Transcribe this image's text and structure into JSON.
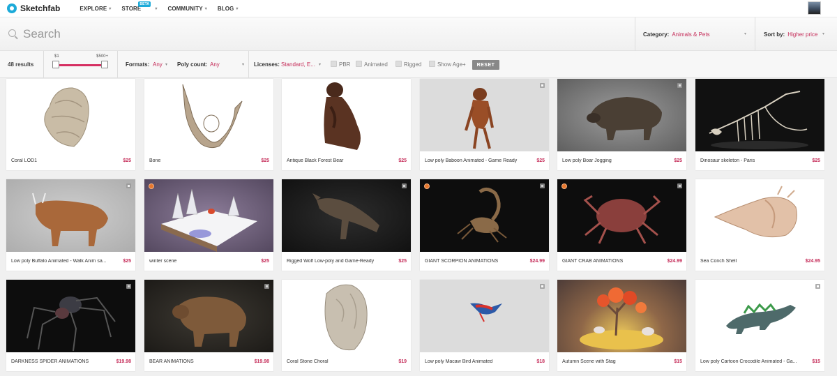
{
  "nav": {
    "logo_text": "Sketchfab",
    "items": [
      {
        "label": "EXPLORE"
      },
      {
        "label": "STORE",
        "badge": "BETA"
      },
      {
        "label": "COMMUNITY"
      },
      {
        "label": "BLOG"
      }
    ]
  },
  "search": {
    "placeholder": "Search"
  },
  "category": {
    "label": "Category:",
    "value": "Animals & Pets"
  },
  "sort": {
    "label": "Sort by:",
    "value": "Higher price"
  },
  "filters": {
    "results": "48 results",
    "price_min": "$1",
    "price_max": "$500+",
    "formats_label": "Formats:",
    "formats_value": "Any",
    "poly_label": "Poly count:",
    "poly_value": "Any",
    "licenses_label": "Licenses:",
    "licenses_value": "Standard, E...",
    "checkboxes": [
      "PBR",
      "Animated",
      "Rigged",
      "Show Age+"
    ],
    "reset_label": "RESET"
  },
  "models": [
    {
      "title": "Coral LOD1",
      "price": "$25"
    },
    {
      "title": "Bone",
      "price": "$25"
    },
    {
      "title": "Antique Black Forest Bear",
      "price": "$25"
    },
    {
      "title": "Low poly Baboon Animated - Game Ready",
      "price": "$25"
    },
    {
      "title": "Low poly Boar Jogging",
      "price": "$25"
    },
    {
      "title": "Dinosaur skeleton - Paris",
      "price": "$25"
    },
    {
      "title": "Low poly Buffalo Animated - Walk Anim sa...",
      "price": "$25"
    },
    {
      "title": "winter scene",
      "price": "$25"
    },
    {
      "title": "Rigged Wolf Low-poly and Game-Ready",
      "price": "$25"
    },
    {
      "title": "GIANT SCORPION ANIMATIONS",
      "price": "$24.99"
    },
    {
      "title": "GIANT CRAB ANIMATIONS",
      "price": "$24.99"
    },
    {
      "title": "Sea Conch Shell",
      "price": "$24.95"
    },
    {
      "title": "DARKNESS SPIDER ANIMATIONS",
      "price": "$19.98"
    },
    {
      "title": "BEAR ANIMATIONS",
      "price": "$19.98"
    },
    {
      "title": "Coral Stone Choral",
      "price": "$19"
    },
    {
      "title": "Low poly Macaw Bird Animated",
      "price": "$18"
    },
    {
      "title": "Autumn Scene with Stag",
      "price": "$15"
    },
    {
      "title": "Low poly Cartoon Crocodile Animated - Ga...",
      "price": "$15"
    }
  ],
  "colors": {
    "accent": "#c52c59",
    "slider": "#d62f62",
    "brand": "#1caad9"
  }
}
